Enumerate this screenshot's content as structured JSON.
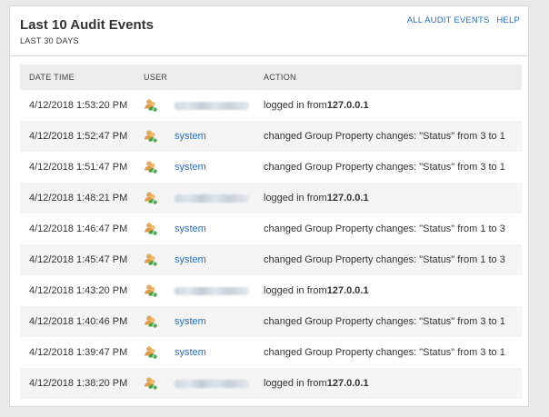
{
  "widget": {
    "title": "Last 10 Audit Events",
    "subtitle": "LAST 30 DAYS",
    "links": {
      "all_events": "ALL AUDIT EVENTS",
      "help": "HELP"
    }
  },
  "table": {
    "columns": {
      "date": "DATE TIME",
      "user": "USER",
      "action": "ACTION"
    },
    "rows": [
      {
        "date": "4/12/2018 1:53:20 PM",
        "user": "",
        "user_redacted": true,
        "action_prefix": "logged in from ",
        "action_bold": "127.0.0.1"
      },
      {
        "date": "4/12/2018 1:52:47 PM",
        "user": "system",
        "user_redacted": false,
        "action_prefix": "changed Group Property changes: \"Status\" from 3 to 1",
        "action_bold": ""
      },
      {
        "date": "4/12/2018 1:51:47 PM",
        "user": "system",
        "user_redacted": false,
        "action_prefix": "changed Group Property changes: \"Status\" from 3 to 1",
        "action_bold": ""
      },
      {
        "date": "4/12/2018 1:48:21 PM",
        "user": "",
        "user_redacted": true,
        "action_prefix": "logged in from ",
        "action_bold": "127.0.0.1"
      },
      {
        "date": "4/12/2018 1:46:47 PM",
        "user": "system",
        "user_redacted": false,
        "action_prefix": "changed Group Property changes: \"Status\" from 1 to 3",
        "action_bold": ""
      },
      {
        "date": "4/12/2018 1:45:47 PM",
        "user": "system",
        "user_redacted": false,
        "action_prefix": "changed Group Property changes: \"Status\" from 1 to 3",
        "action_bold": ""
      },
      {
        "date": "4/12/2018 1:43:20 PM",
        "user": "",
        "user_redacted": true,
        "action_prefix": "logged in from ",
        "action_bold": "127.0.0.1"
      },
      {
        "date": "4/12/2018 1:40:46 PM",
        "user": "system",
        "user_redacted": false,
        "action_prefix": "changed Group Property changes: \"Status\" from 3 to 1",
        "action_bold": ""
      },
      {
        "date": "4/12/2018 1:39:47 PM",
        "user": "system",
        "user_redacted": false,
        "action_prefix": "changed Group Property changes: \"Status\" from 3 to 1",
        "action_bold": ""
      },
      {
        "date": "4/12/2018 1:38:20 PM",
        "user": "",
        "user_redacted": true,
        "action_prefix": "logged in from ",
        "action_bold": "127.0.0.1"
      }
    ]
  },
  "icons": {
    "user": "user-group-icon"
  },
  "colors": {
    "link": "#2a6ebb",
    "header_bg": "#ececec",
    "alt_row_bg": "#f4f4f4",
    "text": "#333333"
  }
}
